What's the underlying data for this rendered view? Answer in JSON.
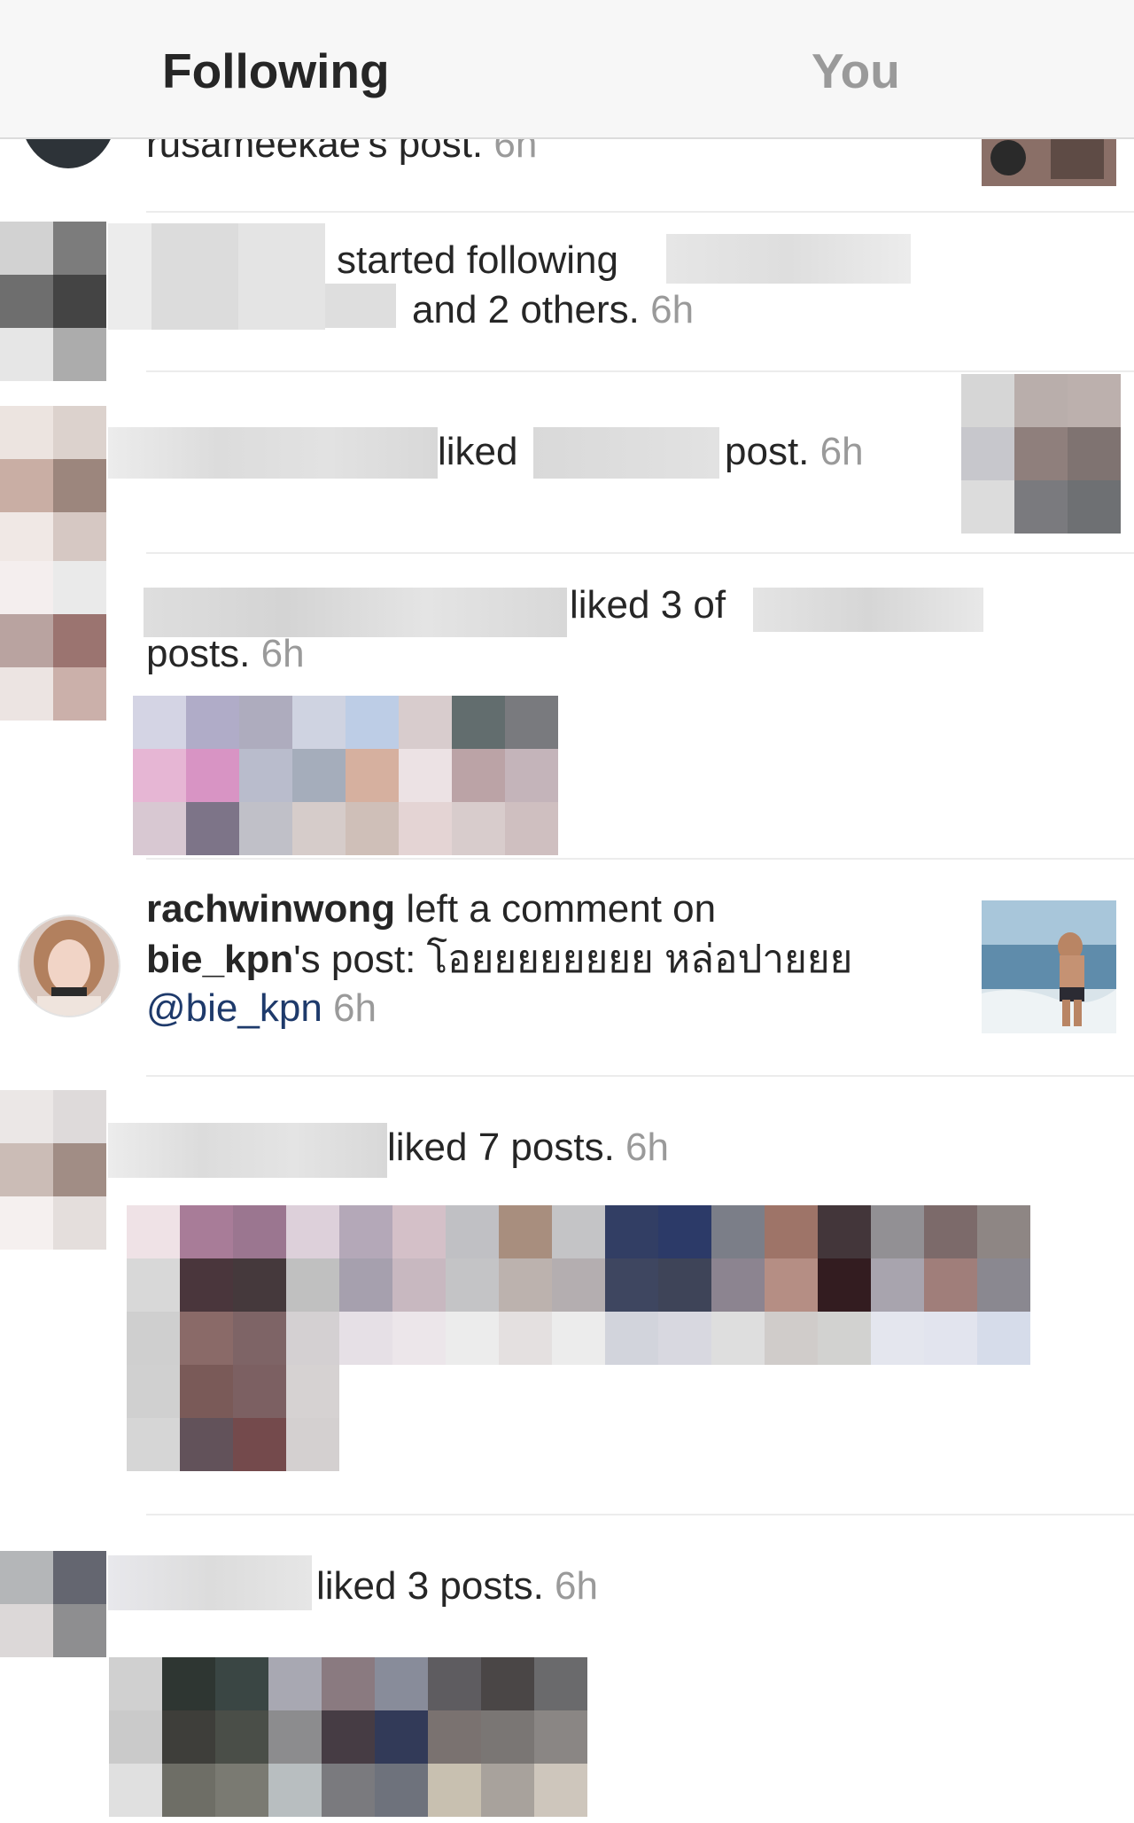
{
  "tabs": {
    "following": "Following",
    "you": "You"
  },
  "items": {
    "top_partial": {
      "text": "rusameekae's post.",
      "time": "6h"
    },
    "follow": {
      "started": "started following",
      "rest": "and 2 others.",
      "time": "6h"
    },
    "liked_one": {
      "liked": "liked",
      "post": "post.",
      "time": "6h"
    },
    "liked_three_of": {
      "liked": "liked 3 of",
      "posts": "posts.",
      "time": "6h"
    },
    "comment": {
      "username": "rachwinwong",
      "action": "left a comment on",
      "target_user": "bie_kpn",
      "target_suffix": "'s post: โอยยยยยยยย หล่อปายยย",
      "mention": "@bie_kpn",
      "time": "6h"
    },
    "liked_seven": {
      "text": "liked 7 posts.",
      "time": "6h"
    },
    "liked_three": {
      "text": "liked 3 posts.",
      "time": "6h"
    }
  },
  "colors": {
    "accent_text": "#262626",
    "muted_text": "#9a9a9a",
    "mention": "#1e3a6b"
  }
}
